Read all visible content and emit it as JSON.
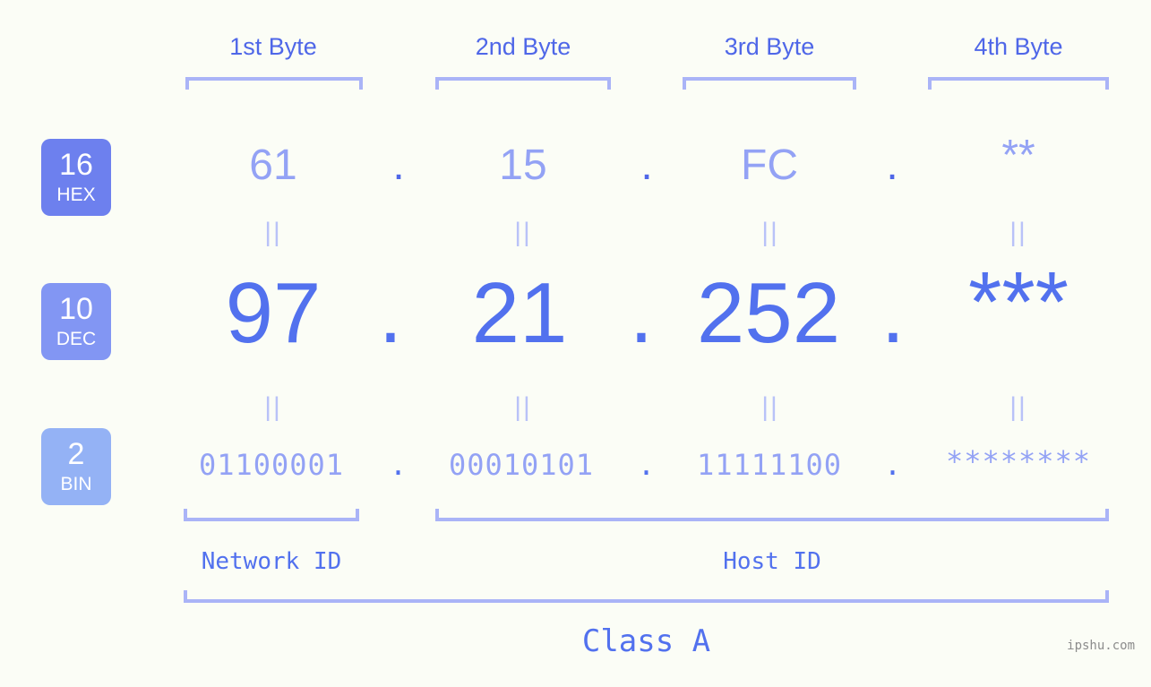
{
  "meta": {
    "watermark": "ipshu.com",
    "background_color": "#fbfdf6",
    "accent_color": "#5271ee",
    "accent_light_color": "#93a2f5",
    "bracket_color": "#aab4f7"
  },
  "byte_headers": [
    {
      "label": "1st Byte"
    },
    {
      "label": "2nd Byte"
    },
    {
      "label": "3rd Byte"
    },
    {
      "label": "4th Byte"
    }
  ],
  "bases": [
    {
      "number": "16",
      "name": "HEX",
      "color": "#6d80ee"
    },
    {
      "number": "10",
      "name": "DEC",
      "color": "#8296f3"
    },
    {
      "number": "2",
      "name": "BIN",
      "color": "#94b2f5"
    }
  ],
  "rows": {
    "hex": {
      "base_number": "16",
      "base_name": "HEX",
      "values": [
        "61",
        "15",
        "FC",
        "**"
      ],
      "separator": "."
    },
    "dec": {
      "base_number": "10",
      "base_name": "DEC",
      "values": [
        "97",
        "21",
        "252",
        "***"
      ],
      "separator": "."
    },
    "bin": {
      "base_number": "2",
      "base_name": "BIN",
      "values": [
        "01100001",
        "00010101",
        "11111100",
        "********"
      ],
      "separator": "."
    }
  },
  "equality_marks": {
    "symbol": "||",
    "count_per_row": 4
  },
  "id_sections": [
    {
      "label": "Network ID"
    },
    {
      "label": "Host ID"
    }
  ],
  "class": {
    "label": "Class A"
  },
  "chart_data": {
    "type": "table",
    "title": "IP address byte breakdown",
    "columns": [
      "1st Byte",
      "2nd Byte",
      "3rd Byte",
      "4th Byte"
    ],
    "rows": [
      {
        "base": "16 HEX",
        "values": [
          "61",
          "15",
          "FC",
          "**"
        ]
      },
      {
        "base": "10 DEC",
        "values": [
          "97",
          "21",
          "252",
          "***"
        ]
      },
      {
        "base": "2 BIN",
        "values": [
          "01100001",
          "00010101",
          "11111100",
          "********"
        ]
      }
    ],
    "groupings": [
      {
        "label": "Network ID",
        "bytes": [
          1
        ]
      },
      {
        "label": "Host ID",
        "bytes": [
          2,
          3,
          4
        ]
      },
      {
        "label": "Class A",
        "bytes": [
          1,
          2,
          3,
          4
        ]
      }
    ]
  }
}
